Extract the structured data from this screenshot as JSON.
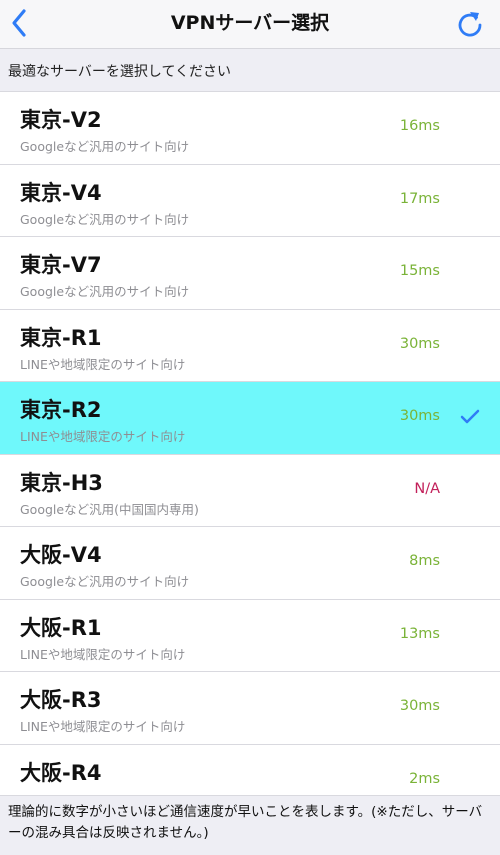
{
  "header": {
    "title": "VPNサーバー選択",
    "back_icon": "chevron-left-icon",
    "refresh_icon": "refresh-icon",
    "accent_color": "#2f7cf6"
  },
  "section_header": "最適なサーバーを選択してください",
  "servers": [
    {
      "name": "東京-V2",
      "desc": "Googleなど汎用のサイト向け",
      "ping": "16ms",
      "selected": false
    },
    {
      "name": "東京-V4",
      "desc": "Googleなど汎用のサイト向け",
      "ping": "17ms",
      "selected": false
    },
    {
      "name": "東京-V7",
      "desc": "Googleなど汎用のサイト向け",
      "ping": "15ms",
      "selected": false
    },
    {
      "name": "東京-R1",
      "desc": "LINEや地域限定のサイト向け",
      "ping": "30ms",
      "selected": false
    },
    {
      "name": "東京-R2",
      "desc": "LINEや地域限定のサイト向け",
      "ping": "30ms",
      "selected": true
    },
    {
      "name": "東京-H3",
      "desc": "Googleなど汎用(中国国内専用)",
      "ping": "N/A",
      "selected": false
    },
    {
      "name": "大阪-V4",
      "desc": "Googleなど汎用のサイト向け",
      "ping": "8ms",
      "selected": false
    },
    {
      "name": "大阪-R1",
      "desc": "LINEや地域限定のサイト向け",
      "ping": "13ms",
      "selected": false
    },
    {
      "name": "大阪-R3",
      "desc": "LINEや地域限定のサイト向け",
      "ping": "30ms",
      "selected": false
    },
    {
      "name": "大阪-R4",
      "desc": "",
      "ping": "2ms",
      "selected": false
    }
  ],
  "colors": {
    "ping_ok": "#7ab338",
    "ping_na": "#c2205a",
    "selected_row": "#6ff8fb",
    "checkmark": "#2f7cf6"
  },
  "footer_text": "理論的に数字が小さいほど通信速度が早いことを表します。(※ただし、サーバーの混み具合は反映されません。)"
}
